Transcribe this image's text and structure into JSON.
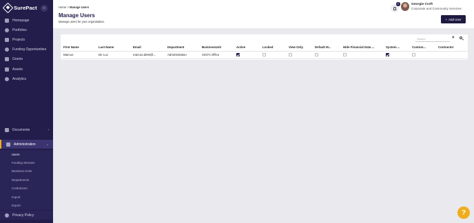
{
  "brand": {
    "name": "SurePact",
    "collapse_icon": "double-chevron-left"
  },
  "sidebar": {
    "items": [
      {
        "label": "Homepage",
        "icon": "home-icon"
      },
      {
        "label": "Portfolios",
        "icon": "portfolio-icon"
      },
      {
        "label": "Projects",
        "icon": "projects-icon"
      },
      {
        "label": "Funding Opportunities",
        "icon": "funding-icon"
      },
      {
        "label": "Grants",
        "icon": "grants-icon"
      },
      {
        "label": "Assets",
        "icon": "assets-icon"
      },
      {
        "label": "Analytics",
        "icon": "analytics-icon"
      }
    ],
    "documents": {
      "label": "Documents"
    },
    "administration": {
      "label": "Administration",
      "children": [
        "Users",
        "Funding Streams",
        "Business Units",
        "Departments",
        "Contractors",
        "Import",
        "Export"
      ],
      "active_child": "Users"
    },
    "privacy": {
      "label": "Privacy Policy"
    }
  },
  "header": {
    "breadcrumb_home": "Home",
    "breadcrumb_sep": " > ",
    "breadcrumb_current": "Manage Users",
    "title": "Manage Users",
    "subtitle": "Manage users for your organisation.",
    "notification_count": "0",
    "user_name": "Georgie Croft",
    "user_org": "Corporate and Community Services",
    "add_user_label": "Add User"
  },
  "search": {
    "placeholder": "Search"
  },
  "table": {
    "columns": [
      "First Name",
      "Last Name",
      "Email",
      "Department",
      "BusinessUnit",
      "Active",
      "Locked",
      "View Only",
      "Default M...",
      "Hide Financial Data ...",
      "System ...",
      "Custom...",
      "Contractor"
    ],
    "rows": [
      {
        "first_name": "Marcus",
        "last_name": "De Luc",
        "email": "marcus.delet@...",
        "department": "Administration",
        "business_unit": "CEO's Office",
        "checks": [
          true,
          false,
          false,
          false,
          false,
          true,
          false
        ]
      }
    ]
  },
  "colors": {
    "sidebar": "#221d4a",
    "accent": "#f0ad1d",
    "primary_button": "#1f1a42"
  }
}
